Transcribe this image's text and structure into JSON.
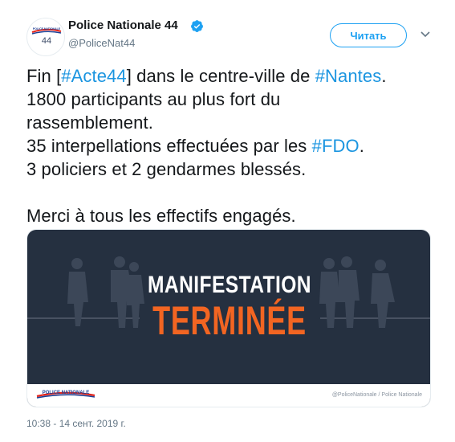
{
  "author": {
    "display_name": "Police Nationale 44",
    "handle": "@PoliceNat44",
    "avatar_logo_text": "POLICE NATIONALE",
    "avatar_number": "44",
    "verified": true
  },
  "follow_label": "Читать",
  "tweet_lines": [
    [
      {
        "t": "Fin ["
      },
      {
        "t": "#Acte44",
        "tag": true
      },
      {
        "t": "] dans le centre-ville de "
      },
      {
        "t": "#Nantes",
        "tag": true
      },
      {
        "t": "."
      }
    ],
    [
      {
        "t": "1800 participants au plus fort du"
      }
    ],
    [
      {
        "t": "rassemblement."
      }
    ],
    [
      {
        "t": "35 interpellations effectuées par les "
      },
      {
        "t": "#FDO",
        "tag": true
      },
      {
        "t": "."
      }
    ],
    [
      {
        "t": "3 policiers et 2 gendarmes blessés."
      }
    ],
    [],
    [
      {
        "t": "Merci à tous les effectifs engagés."
      }
    ]
  ],
  "media": {
    "title": "MANIFESTATION",
    "subtitle": "TERMINÉE",
    "logo_text": "POLICE NATIONALE",
    "credit": "@PoliceNationale   / Police Nationale",
    "background_color": "#253040",
    "accent_color": "#f26522"
  },
  "timestamp": "10:38 - 14 сент. 2019 г.",
  "colors": {
    "link": "#1b95e0",
    "follow_border": "#1da1f2",
    "muted": "#657786"
  }
}
